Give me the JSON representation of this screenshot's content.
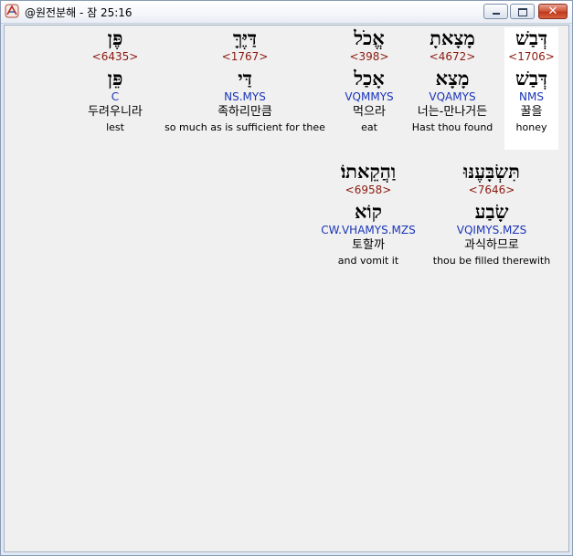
{
  "window": {
    "title": "@원전분해 - 잠 25:16"
  },
  "icons": {
    "app": "app-logo-icon",
    "minimize": "minimize-icon",
    "maximize": "maximize-icon",
    "close": "close-icon"
  },
  "colors": {
    "strong_number": "#8b1a10",
    "morphology": "#1a35b8",
    "highlight_background": "#ffffff"
  },
  "words": [
    {
      "hebrew": "דְּבַשׁ",
      "strong": "<1706>",
      "lemma": "דְּבַשׁ",
      "morph": "NMS",
      "korean": "꿀을",
      "gloss": "honey",
      "highlighted": true
    },
    {
      "hebrew": "מָצָאתָ",
      "strong": "<4672>",
      "lemma": "מָצָא",
      "morph": "VQAMYS",
      "korean": "너는-만나거든",
      "gloss": "Hast thou found",
      "highlighted": false
    },
    {
      "hebrew": "אֱכֹל",
      "strong": "<398>",
      "lemma": "אָכַל",
      "morph": "VQMMYS",
      "korean": "먹으라",
      "gloss": "eat",
      "highlighted": false
    },
    {
      "hebrew": "דַּיֶּךָּ",
      "strong": "<1767>",
      "lemma": "דַּי",
      "morph": "NS.MYS",
      "korean": "족하리만큼",
      "gloss": "so much as is sufficient for thee",
      "highlighted": false
    },
    {
      "hebrew": "פֶּן",
      "strong": "<6435>",
      "lemma": "פֵּן",
      "morph": "C",
      "korean": "두려우니라",
      "gloss": "lest",
      "highlighted": false
    },
    {
      "hebrew": "תִּשְׂבָּעֶנּוּ",
      "strong": "<7646>",
      "lemma": "שָׂבַע",
      "morph": "VQIMYS.MZS",
      "korean": "과식하므로",
      "gloss": "thou be filled therewith",
      "highlighted": false
    },
    {
      "hebrew": "וַהֲקֵאתוֹ׃",
      "strong": "<6958>",
      "lemma": "קוֹא",
      "morph": "CW.VHAMYS.MZS",
      "korean": "토할까",
      "gloss": "and vomit it",
      "highlighted": false
    }
  ]
}
